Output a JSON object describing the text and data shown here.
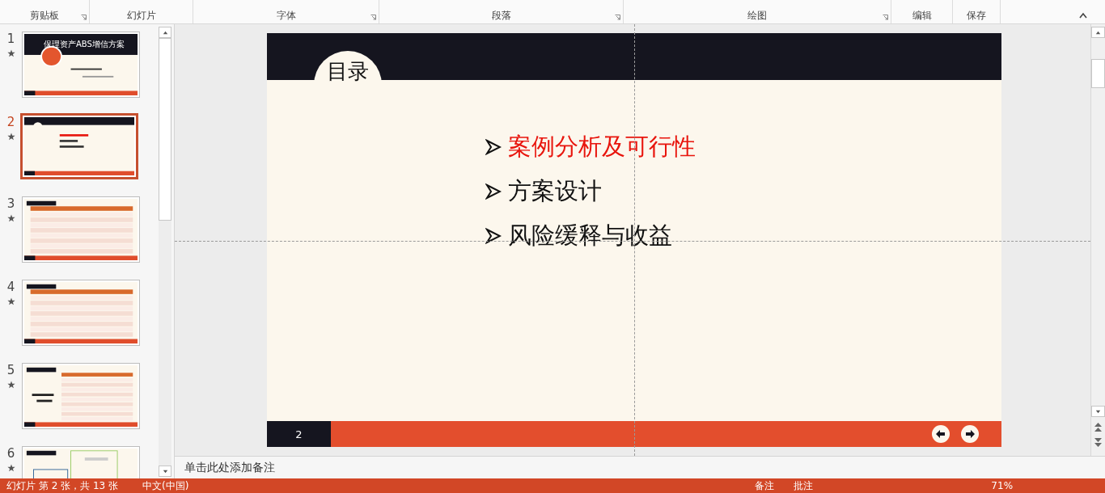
{
  "ribbon": {
    "groups": [
      {
        "label": "剪贴板",
        "launcher": true
      },
      {
        "label": "幻灯片",
        "launcher": false
      },
      {
        "label": "字体",
        "launcher": true
      },
      {
        "label": "段落",
        "launcher": true
      },
      {
        "label": "绘图",
        "launcher": true
      },
      {
        "label": "编辑",
        "launcher": false
      },
      {
        "label": "保存",
        "launcher": false
      }
    ]
  },
  "thumbnails": [
    {
      "number": "1",
      "selected": false,
      "kind": "title",
      "title": "保理资产ABS增信方案"
    },
    {
      "number": "2",
      "selected": true,
      "kind": "agenda"
    },
    {
      "number": "3",
      "selected": false,
      "kind": "table"
    },
    {
      "number": "4",
      "selected": false,
      "kind": "table"
    },
    {
      "number": "5",
      "selected": false,
      "kind": "grid"
    },
    {
      "number": "6",
      "selected": false,
      "kind": "diagram"
    }
  ],
  "slide": {
    "heading": "目录",
    "items": [
      {
        "text": "案例分析及可行性",
        "highlighted": true
      },
      {
        "text": "方案设计",
        "highlighted": false
      },
      {
        "text": "风险缓释与收益",
        "highlighted": false
      }
    ],
    "page_number": "2"
  },
  "notes": {
    "placeholder": "单击此处添加备注"
  },
  "status_bar": {
    "slide_info": "幻灯片 第 2 张，共 13 张",
    "language": "中文(中国)",
    "notes": "备注",
    "comments": "批注",
    "zoom": "71%"
  }
}
